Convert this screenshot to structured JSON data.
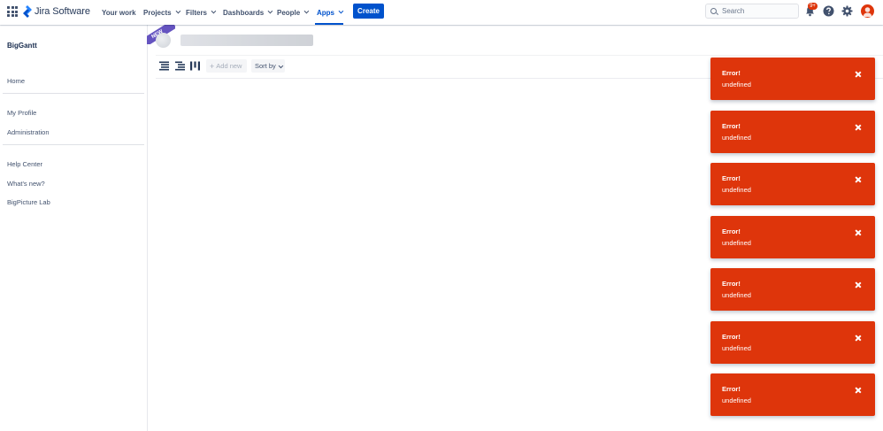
{
  "app": {
    "brand": "Jira Software",
    "brand_color": "#0052cc"
  },
  "nav": {
    "items": [
      {
        "label": "Your work",
        "has_dropdown": false,
        "active": false
      },
      {
        "label": "Projects",
        "has_dropdown": true,
        "active": false
      },
      {
        "label": "Filters",
        "has_dropdown": true,
        "active": false
      },
      {
        "label": "Dashboards",
        "has_dropdown": true,
        "active": false
      },
      {
        "label": "People",
        "has_dropdown": true,
        "active": false
      },
      {
        "label": "Apps",
        "has_dropdown": true,
        "active": true
      }
    ],
    "create_label": "Create",
    "search_placeholder": "Search",
    "notification_badge": "9+",
    "icons": [
      "app-switcher-icon",
      "bell-icon",
      "help-icon",
      "gear-icon",
      "avatar"
    ]
  },
  "sidebar": {
    "title": "BigGantt",
    "groups": [
      [
        "Home"
      ],
      [
        "My Profile",
        "Administration"
      ],
      [
        "Help Center",
        "What's new?",
        "BigPicture Lab"
      ]
    ]
  },
  "main": {
    "ribbon": "NEW",
    "toolbar": {
      "view_icons": [
        "list-view-icon",
        "outline-view-icon",
        "board-view-icon"
      ],
      "add_new_label": "Add new",
      "sort_by_label": "Sort by"
    }
  },
  "flags": [
    {
      "title": "Error!",
      "description": "undefined"
    },
    {
      "title": "Error!",
      "description": "undefined"
    },
    {
      "title": "Error!",
      "description": "undefined"
    },
    {
      "title": "Error!",
      "description": "undefined"
    },
    {
      "title": "Error!",
      "description": "undefined"
    },
    {
      "title": "Error!",
      "description": "undefined"
    },
    {
      "title": "Error!",
      "description": "undefined"
    }
  ],
  "colors": {
    "error_flag": "#de350b",
    "new_ribbon": "#6554c0",
    "text_primary": "#172b4d",
    "text_secondary": "#42526e"
  }
}
